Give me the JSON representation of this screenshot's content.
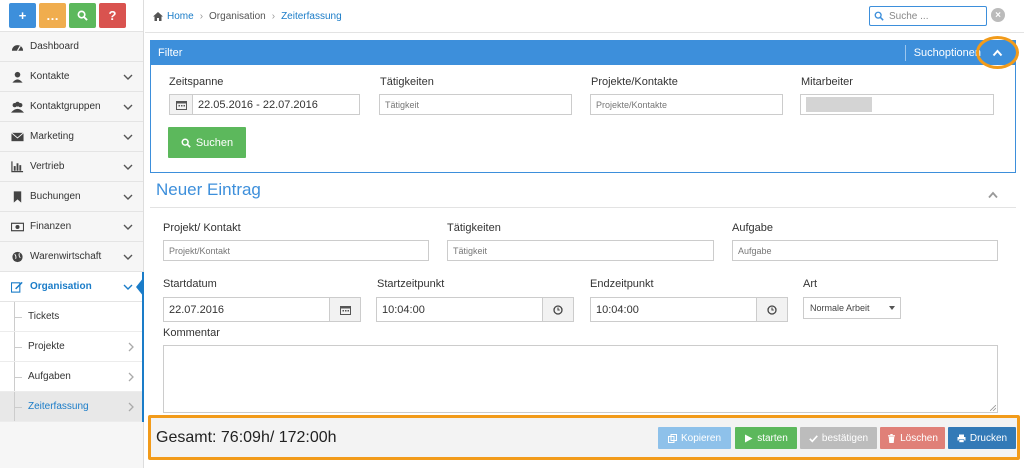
{
  "quick_buttons": [
    {
      "glyph": "+",
      "color": "#3d8fdb"
    },
    {
      "glyph": "…",
      "color": "#f0ad4e"
    },
    {
      "glyph": "⚲",
      "color": "#5cb85c"
    },
    {
      "glyph": "?",
      "color": "#d9534f"
    }
  ],
  "sidebar": {
    "items": [
      {
        "label": "Dashboard",
        "icon": "dashboard-icon"
      },
      {
        "label": "Kontakte",
        "icon": "user-icon"
      },
      {
        "label": "Kontaktgruppen",
        "icon": "users-icon"
      },
      {
        "label": "Marketing",
        "icon": "envelope-icon"
      },
      {
        "label": "Vertrieb",
        "icon": "bar-chart-icon"
      },
      {
        "label": "Buchungen",
        "icon": "bookmark-icon"
      },
      {
        "label": "Finanzen",
        "icon": "money-icon"
      },
      {
        "label": "Warenwirtschaft",
        "icon": "globe-icon"
      },
      {
        "label": "Organisation",
        "icon": "edit-icon"
      }
    ],
    "sub_items": [
      {
        "label": "Tickets"
      },
      {
        "label": "Projekte"
      },
      {
        "label": "Aufgaben"
      },
      {
        "label": "Zeiterfassung"
      }
    ]
  },
  "breadcrumb": {
    "home": "Home",
    "section": "Organisation",
    "current": "Zeiterfassung"
  },
  "search": {
    "placeholder": "Suche ..."
  },
  "filter": {
    "title": "Filter",
    "options_label": "Suchoptionen",
    "zeitspanne_label": "Zeitspanne",
    "zeitspanne_value": "22.05.2016 - 22.07.2016",
    "taetigkeiten_label": "Tätigkeiten",
    "taetigkeiten_placeholder": "Tätigkeit",
    "projekte_label": "Projekte/Kontakte",
    "projekte_placeholder": "Projekte/Kontakte",
    "mitarbeiter_label": "Mitarbeiter",
    "search_button": "Suchen"
  },
  "entry": {
    "title": "Neuer Eintrag",
    "projekt_label": "Projekt/ Kontakt",
    "projekt_placeholder": "Projekt/Kontakt",
    "taetigkeiten_label": "Tätigkeiten",
    "taetigkeiten_placeholder": "Tätigkeit",
    "aufgabe_label": "Aufgabe",
    "aufgabe_placeholder": "Aufgabe",
    "startdatum_label": "Startdatum",
    "startdatum_value": "22.07.2016",
    "startzeit_label": "Startzeitpunkt",
    "startzeit_value": "10:04:00",
    "endzeit_label": "Endzeitpunkt",
    "endzeit_value": "10:04:00",
    "art_label": "Art",
    "art_value": "Normale Arbeit",
    "kommentar_label": "Kommentar"
  },
  "footer": {
    "total": "Gesamt: 76:09h/ 172:00h",
    "buttons": {
      "kopieren": "Kopieren",
      "starten": "starten",
      "bestaetigen": "bestätigen",
      "loeschen": "Löschen",
      "drucken": "Drucken"
    }
  },
  "colors": {
    "accent": "#3d8fdb",
    "highlight": "#f29b1a",
    "success": "#5cb85c",
    "danger": "#d9534f"
  }
}
